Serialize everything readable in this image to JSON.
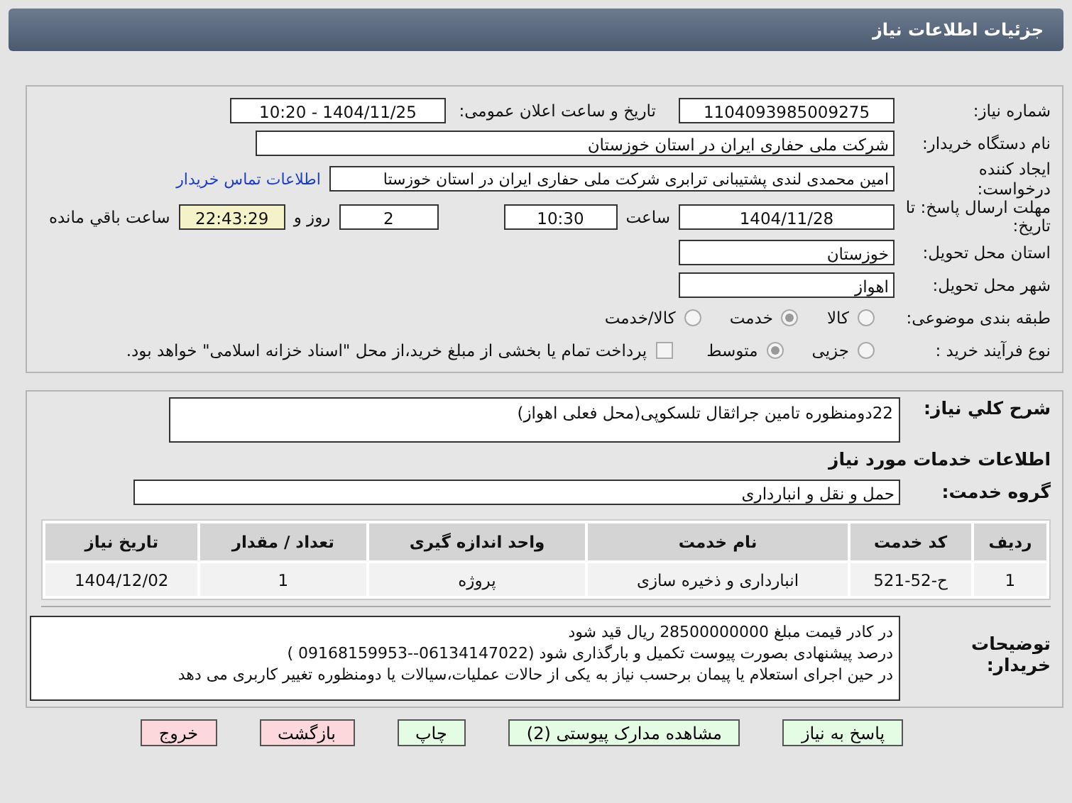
{
  "header": {
    "title": "جزئیات اطلاعات نیاز"
  },
  "details": {
    "need_number": {
      "label": "شماره نیاز:",
      "value": "1104093985009275"
    },
    "announce": {
      "label": "تاریخ و ساعت اعلان عمومی:",
      "value": "1404/11/25 - 10:20"
    },
    "buyer": {
      "label": "نام دستگاه خریدار:",
      "value": "شرکت ملی حفاری ایران در استان خوزستان"
    },
    "creator": {
      "label": "ایجاد کننده درخواست:",
      "value": "امین محمدی لندی پشتیبانی ترابری شرکت ملی حفاری ایران در استان خوزستا",
      "link": "اطلاعات تماس خریدار"
    },
    "deadline": {
      "label": "مهلت ارسال پاسخ: تا تاریخ:",
      "date": "1404/11/28",
      "time_label": "ساعت",
      "time": "10:30",
      "days": "2",
      "days_label": "روز و",
      "remaining": "22:43:29",
      "remaining_label": "ساعت باقي مانده"
    },
    "province": {
      "label": "استان محل تحویل:",
      "value": "خوزستان"
    },
    "city": {
      "label": "شهر محل تحویل:",
      "value": "اهواز"
    },
    "category": {
      "label": "طبقه بندی موضوعی:",
      "options": [
        {
          "label": "کالا",
          "selected": false
        },
        {
          "label": "خدمت",
          "selected": true
        },
        {
          "label": "کالا/خدمت",
          "selected": false
        }
      ]
    },
    "process": {
      "label": "نوع فرآیند خرید :",
      "options": [
        {
          "label": "جزیی",
          "selected": false
        },
        {
          "label": "متوسط",
          "selected": true
        }
      ],
      "payment": {
        "checked": false,
        "text": "پرداخت تمام یا بخشی از مبلغ خرید،از محل \"اسناد خزانه اسلامی\" خواهد بود."
      }
    }
  },
  "need": {
    "description_label": "شرح کلي نياز:",
    "description": "22دومنظوره تامین جراثقال تلسکوپی(محل فعلی اهواز)",
    "services_heading": "اطلاعات خدمات مورد نیاز",
    "group_label": "گروه خدمت:",
    "group": "حمل و نقل و انبارداری",
    "table": {
      "columns": [
        "ردیف",
        "کد خدمت",
        "نام خدمت",
        "واحد اندازه گیری",
        "تعداد / مقدار",
        "تاریخ نیاز"
      ],
      "rows": [
        [
          "1",
          "ح-52-521",
          "انبارداری و ذخیره سازی",
          "پروژه",
          "1",
          "1404/12/02"
        ]
      ]
    },
    "notes_label": "توضیحات خریدار:",
    "notes": [
      "در کادر قیمت مبلغ 28500000000 ریال قید شود",
      "درصد پیشنهادی بصورت پیوست تکمیل و بارگذاری شود (06134147022--09168159953 )",
      "در حین اجرای استعلام یا پیمان برحسب نیاز به یکی از حالات عملیات،سیالات یا دومنظوره تغییر کاربری می دهد"
    ]
  },
  "buttons": [
    {
      "label": "پاسخ به نیاز",
      "kind": "primary"
    },
    {
      "label": "مشاهده مدارک پیوستی (2)",
      "kind": "primary"
    },
    {
      "label": "چاپ",
      "kind": "primary"
    },
    {
      "label": "بازگشت",
      "kind": "danger"
    },
    {
      "label": "خروج",
      "kind": "danger"
    }
  ]
}
